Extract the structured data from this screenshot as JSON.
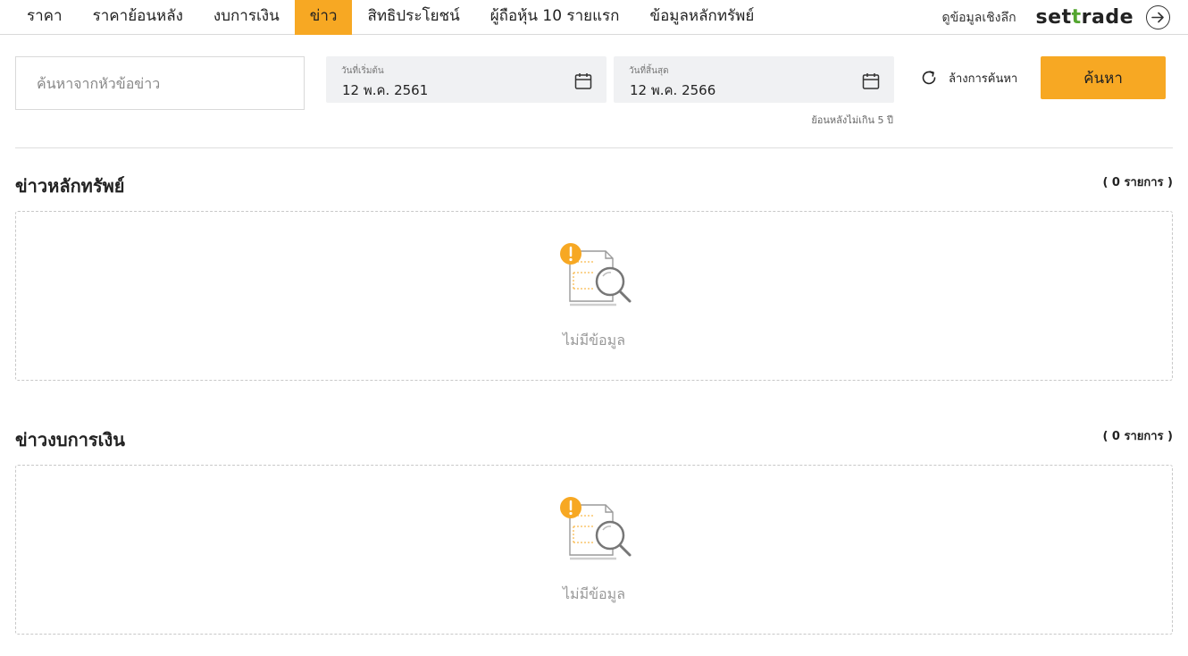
{
  "nav": {
    "tabs": [
      {
        "label": "ราคา"
      },
      {
        "label": "ราคาย้อนหลัง"
      },
      {
        "label": "งบการเงิน"
      },
      {
        "label": "ข่าว"
      },
      {
        "label": "สิทธิประโยชน์"
      },
      {
        "label": "ผู้ถือหุ้น 10 รายแรก"
      },
      {
        "label": "ข้อมูลหลักทรัพย์"
      }
    ],
    "active_tab": "ข่าว",
    "deep_link": "ดูข้อมูลเชิงลึก",
    "logo_part1": "set",
    "logo_part2": "t",
    "logo_part3": "rade",
    "accent_color": "#f7a823",
    "logo_accent_color": "#54a630"
  },
  "filters": {
    "search_placeholder": "ค้นหาจากหัวข้อข่าว",
    "start_date_label": "วันที่เริ่มต้น",
    "start_date_value": "12 พ.ค. 2561",
    "end_date_label": "วันที่สิ้นสุด",
    "end_date_value": "12 พ.ค. 2566",
    "range_hint": "ย้อนหลังไม่เกิน 5 ปี",
    "clear_label": "ล้างการค้นหา",
    "search_button": "ค้นหา"
  },
  "sections": [
    {
      "title": "ข่าวหลักทรัพย์",
      "count": "( 0 รายการ )",
      "empty_text": "ไม่มีข้อมูล"
    },
    {
      "title": "ข่าวงบการเงิน",
      "count": "( 0 รายการ )",
      "empty_text": "ไม่มีข้อมูล"
    }
  ]
}
